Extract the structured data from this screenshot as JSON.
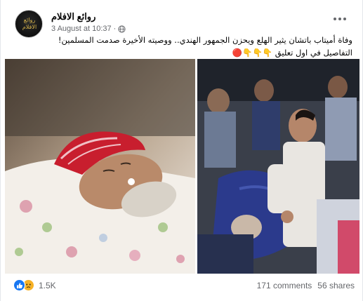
{
  "post": {
    "page_name": "روائع الافلام",
    "timestamp": "3 August at 10:37",
    "privacy_icon": "globe-icon",
    "avatar_text": "روائع الافلام",
    "text_line1": "وفاة أميتاب باتشان يثير الهلع ويحزن الجمهور الهندي.. ووصيته الأخيرة صدمت المسلمين!",
    "text_line2": "التفاصيل في اول تعليق",
    "emojis": "👇👇👇🔴"
  },
  "footer": {
    "reactions_count": "1.5K",
    "comments": "171 comments",
    "shares": "56 shares"
  },
  "colors": {
    "like_blue": "#1877f2",
    "sad_yellow": "#f7b125",
    "secondary_text": "#65676b"
  }
}
